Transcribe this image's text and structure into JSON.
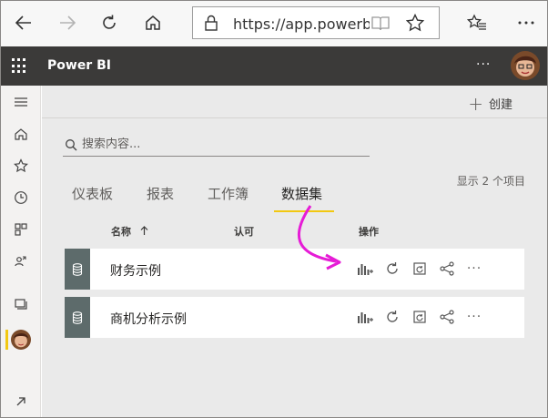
{
  "browser": {
    "url": "https://app.powerbi.com"
  },
  "app": {
    "brand": "Power BI",
    "more": "···"
  },
  "toolbar": {
    "create_label": "创建"
  },
  "search": {
    "placeholder": "搜索内容..."
  },
  "tabs": [
    {
      "label": "仪表板"
    },
    {
      "label": "报表"
    },
    {
      "label": "工作簿"
    },
    {
      "label": "数据集"
    }
  ],
  "active_tab": "数据集",
  "item_count": "显示 2 个项目",
  "columns": {
    "name": "名称",
    "endorsement": "认可",
    "actions": "操作"
  },
  "rows": [
    {
      "name": "财务示例"
    },
    {
      "name": "商机分析示例"
    }
  ],
  "colors": {
    "accent": "#f2c811",
    "arrow": "#e61cd6",
    "header": "#3b3a39",
    "row_icon": "#5d6b6b"
  }
}
